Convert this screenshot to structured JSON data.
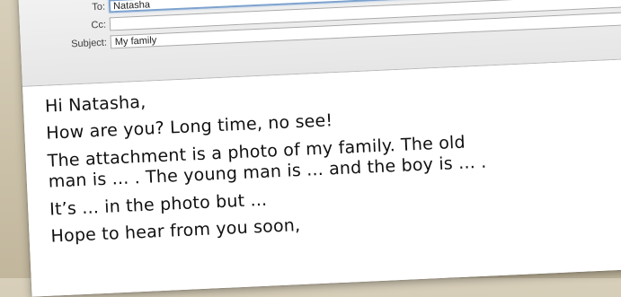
{
  "compose": {
    "to_label": "To:",
    "to_value": "Natasha",
    "cc_label": "Cc:",
    "cc_value": "",
    "subject_label": "Subject:",
    "subject_value": "My family"
  },
  "body": {
    "lines": [
      "Hi Natasha,",
      "How are you? Long time, no see!",
      "The attachment is a photo of my family. The old",
      "man is ... . The young man is ... and the boy is ... .",
      "It’s ... in the photo but ...",
      "Hope to hear from you soon,"
    ]
  },
  "colors": {
    "background": "#cbc1a9",
    "header": "#e9e9e9",
    "focus_ring": "#7da2ce"
  }
}
